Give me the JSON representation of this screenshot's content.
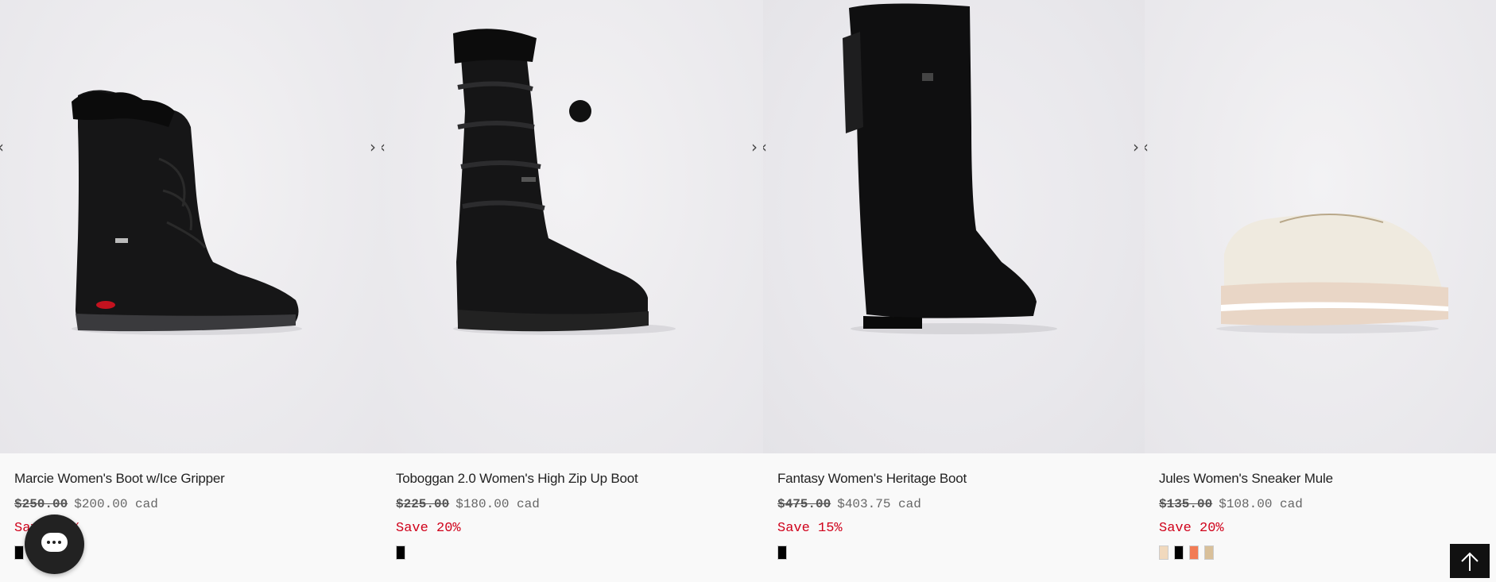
{
  "products": [
    {
      "title": "Marcie Women's Boot w/Ice Gripper",
      "old_price": "$250.00",
      "new_price": "$200.00 cad",
      "save": "Save 20%",
      "swatches": [
        "#000000"
      ]
    },
    {
      "title": "Toboggan 2.0 Women's High Zip Up Boot",
      "old_price": "$225.00",
      "new_price": "$180.00 cad",
      "save": "Save 20%",
      "swatches": [
        "#000000"
      ]
    },
    {
      "title": "Fantasy Women's Heritage Boot",
      "old_price": "$475.00",
      "new_price": "$403.75 cad",
      "save": "Save 15%",
      "swatches": [
        "#000000"
      ]
    },
    {
      "title": "Jules Women's Sneaker Mule",
      "old_price": "$135.00",
      "new_price": "$108.00 cad",
      "save": "Save 20%",
      "swatches": [
        "#f1d9bd",
        "#000000",
        "#f27c55",
        "#d9c09a"
      ]
    }
  ],
  "carousel": {
    "prev_glyph": "‹",
    "next_glyph": "›"
  },
  "colors": {
    "sale": "#d0021b",
    "chat_bg": "#222222",
    "back_to_top_bg": "#111111"
  }
}
